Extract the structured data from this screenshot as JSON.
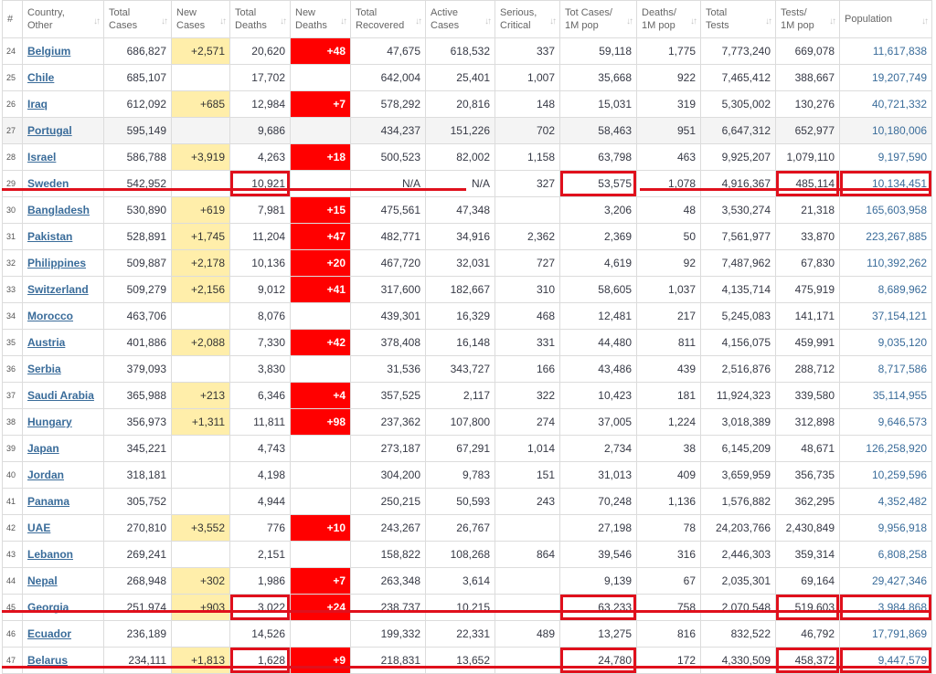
{
  "table": {
    "headers": [
      {
        "label": "#",
        "sort": false
      },
      {
        "label": "Country,\nOther",
        "sort": true
      },
      {
        "label": "Total\nCases",
        "sort": true
      },
      {
        "label": "New\nCases",
        "sort": true
      },
      {
        "label": "Total\nDeaths",
        "sort": true
      },
      {
        "label": "New\nDeaths",
        "sort": true
      },
      {
        "label": "Total\nRecovered",
        "sort": true
      },
      {
        "label": "Active\nCases",
        "sort": true
      },
      {
        "label": "Serious,\nCritical",
        "sort": true
      },
      {
        "label": "Tot Cases/\n1M pop",
        "sort": true
      },
      {
        "label": "Deaths/\n1M pop",
        "sort": true
      },
      {
        "label": "Total\nTests",
        "sort": true
      },
      {
        "label": "Tests/\n1M pop",
        "sort": true
      },
      {
        "label": "Population",
        "sort": true
      }
    ],
    "rows": [
      [
        "24",
        "Belgium",
        "686,827",
        "+2,571",
        "20,620",
        "+48",
        "47,675",
        "618,532",
        "337",
        "59,118",
        "1,775",
        "7,773,240",
        "669,078",
        "11,617,838"
      ],
      [
        "25",
        "Chile",
        "685,107",
        "",
        "17,702",
        "",
        "642,004",
        "25,401",
        "1,007",
        "35,668",
        "922",
        "7,465,412",
        "388,667",
        "19,207,749"
      ],
      [
        "26",
        "Iraq",
        "612,092",
        "+685",
        "12,984",
        "+7",
        "578,292",
        "20,816",
        "148",
        "15,031",
        "319",
        "5,305,002",
        "130,276",
        "40,721,332"
      ],
      [
        "27",
        "Portugal",
        "595,149",
        "",
        "9,686",
        "",
        "434,237",
        "151,226",
        "702",
        "58,463",
        "951",
        "6,647,312",
        "652,977",
        "10,180,006"
      ],
      [
        "28",
        "Israel",
        "586,788",
        "+3,919",
        "4,263",
        "+18",
        "500,523",
        "82,002",
        "1,158",
        "63,798",
        "463",
        "9,925,207",
        "1,079,110",
        "9,197,590"
      ],
      [
        "29",
        "Sweden",
        "542,952",
        "",
        "10,921",
        "",
        "N/A",
        "N/A",
        "327",
        "53,575",
        "1,078",
        "4,916,367",
        "485,114",
        "10,134,451"
      ],
      [
        "30",
        "Bangladesh",
        "530,890",
        "+619",
        "7,981",
        "+15",
        "475,561",
        "47,348",
        "",
        "3,206",
        "48",
        "3,530,274",
        "21,318",
        "165,603,958"
      ],
      [
        "31",
        "Pakistan",
        "528,891",
        "+1,745",
        "11,204",
        "+47",
        "482,771",
        "34,916",
        "2,362",
        "2,369",
        "50",
        "7,561,977",
        "33,870",
        "223,267,885"
      ],
      [
        "32",
        "Philippines",
        "509,887",
        "+2,178",
        "10,136",
        "+20",
        "467,720",
        "32,031",
        "727",
        "4,619",
        "92",
        "7,487,962",
        "67,830",
        "110,392,262"
      ],
      [
        "33",
        "Switzerland",
        "509,279",
        "+2,156",
        "9,012",
        "+41",
        "317,600",
        "182,667",
        "310",
        "58,605",
        "1,037",
        "4,135,714",
        "475,919",
        "8,689,962"
      ],
      [
        "34",
        "Morocco",
        "463,706",
        "",
        "8,076",
        "",
        "439,301",
        "16,329",
        "468",
        "12,481",
        "217",
        "5,245,083",
        "141,171",
        "37,154,121"
      ],
      [
        "35",
        "Austria",
        "401,886",
        "+2,088",
        "7,330",
        "+42",
        "378,408",
        "16,148",
        "331",
        "44,480",
        "811",
        "4,156,075",
        "459,991",
        "9,035,120"
      ],
      [
        "36",
        "Serbia",
        "379,093",
        "",
        "3,830",
        "",
        "31,536",
        "343,727",
        "166",
        "43,486",
        "439",
        "2,516,876",
        "288,712",
        "8,717,586"
      ],
      [
        "37",
        "Saudi Arabia",
        "365,988",
        "+213",
        "6,346",
        "+4",
        "357,525",
        "2,117",
        "322",
        "10,423",
        "181",
        "11,924,323",
        "339,580",
        "35,114,955"
      ],
      [
        "38",
        "Hungary",
        "356,973",
        "+1,311",
        "11,811",
        "+98",
        "237,362",
        "107,800",
        "274",
        "37,005",
        "1,224",
        "3,018,389",
        "312,898",
        "9,646,573"
      ],
      [
        "39",
        "Japan",
        "345,221",
        "",
        "4,743",
        "",
        "273,187",
        "67,291",
        "1,014",
        "2,734",
        "38",
        "6,145,209",
        "48,671",
        "126,258,920"
      ],
      [
        "40",
        "Jordan",
        "318,181",
        "",
        "4,198",
        "",
        "304,200",
        "9,783",
        "151",
        "31,013",
        "409",
        "3,659,959",
        "356,735",
        "10,259,596"
      ],
      [
        "41",
        "Panama",
        "305,752",
        "",
        "4,944",
        "",
        "250,215",
        "50,593",
        "243",
        "70,248",
        "1,136",
        "1,576,882",
        "362,295",
        "4,352,482"
      ],
      [
        "42",
        "UAE",
        "270,810",
        "+3,552",
        "776",
        "+10",
        "243,267",
        "26,767",
        "",
        "27,198",
        "78",
        "24,203,766",
        "2,430,849",
        "9,956,918"
      ],
      [
        "43",
        "Lebanon",
        "269,241",
        "",
        "2,151",
        "",
        "158,822",
        "108,268",
        "864",
        "39,546",
        "316",
        "2,446,303",
        "359,314",
        "6,808,258"
      ],
      [
        "44",
        "Nepal",
        "268,948",
        "+302",
        "1,986",
        "+7",
        "263,348",
        "3,614",
        "",
        "9,139",
        "67",
        "2,035,301",
        "69,164",
        "29,427,346"
      ],
      [
        "45",
        "Georgia",
        "251,974",
        "+903",
        "3,022",
        "+24",
        "238,737",
        "10,215",
        "",
        "63,233",
        "758",
        "2,070,548",
        "519,603",
        "3,984,868"
      ],
      [
        "46",
        "Ecuador",
        "236,189",
        "",
        "14,526",
        "",
        "199,332",
        "22,331",
        "489",
        "13,275",
        "816",
        "832,522",
        "46,792",
        "17,791,869"
      ],
      [
        "47",
        "Belarus",
        "234,111",
        "+1,813",
        "1,628",
        "+9",
        "218,831",
        "13,652",
        "",
        "24,780",
        "172",
        "4,330,509",
        "458,372",
        "9,447,579"
      ]
    ]
  },
  "annotations": {
    "color": "#e0101c",
    "highlighted_rows": [
      "Sweden",
      "Georgia",
      "Belarus"
    ],
    "boxed_columns": [
      "Total Deaths",
      "Tot Cases/ 1M pop",
      "Tests/ 1M pop",
      "Population"
    ]
  }
}
